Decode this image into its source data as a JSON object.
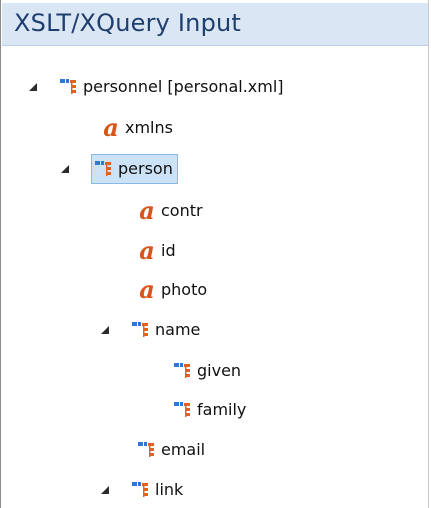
{
  "panel": {
    "title": "XSLT/XQuery Input"
  },
  "tree": {
    "nodes": [
      {
        "label": "personnel [personal.xml]",
        "type": "element",
        "expanded": true
      },
      {
        "label": "xmlns",
        "type": "attribute"
      },
      {
        "label": "person",
        "type": "element",
        "expanded": true,
        "selected": true
      },
      {
        "label": "contr",
        "type": "attribute"
      },
      {
        "label": "id",
        "type": "attribute"
      },
      {
        "label": "photo",
        "type": "attribute"
      },
      {
        "label": "name",
        "type": "element",
        "expanded": true
      },
      {
        "label": "given",
        "type": "element"
      },
      {
        "label": "family",
        "type": "element"
      },
      {
        "label": "email",
        "type": "element"
      },
      {
        "label": "link",
        "type": "element",
        "expanded": true
      }
    ]
  },
  "icons": {
    "element": "xml-element-icon",
    "attribute": "xml-attribute-icon",
    "expanded": "expanded-triangle-icon"
  },
  "colors": {
    "title_bg": "#dbe6f4",
    "title_text": "#1e3f6e",
    "selection_bg": "#cce3f7",
    "selection_border": "#88b9e6",
    "element_icon_blue": "#2f78d6",
    "element_icon_orange": "#e0621e",
    "attribute_icon": "#d9541b"
  }
}
